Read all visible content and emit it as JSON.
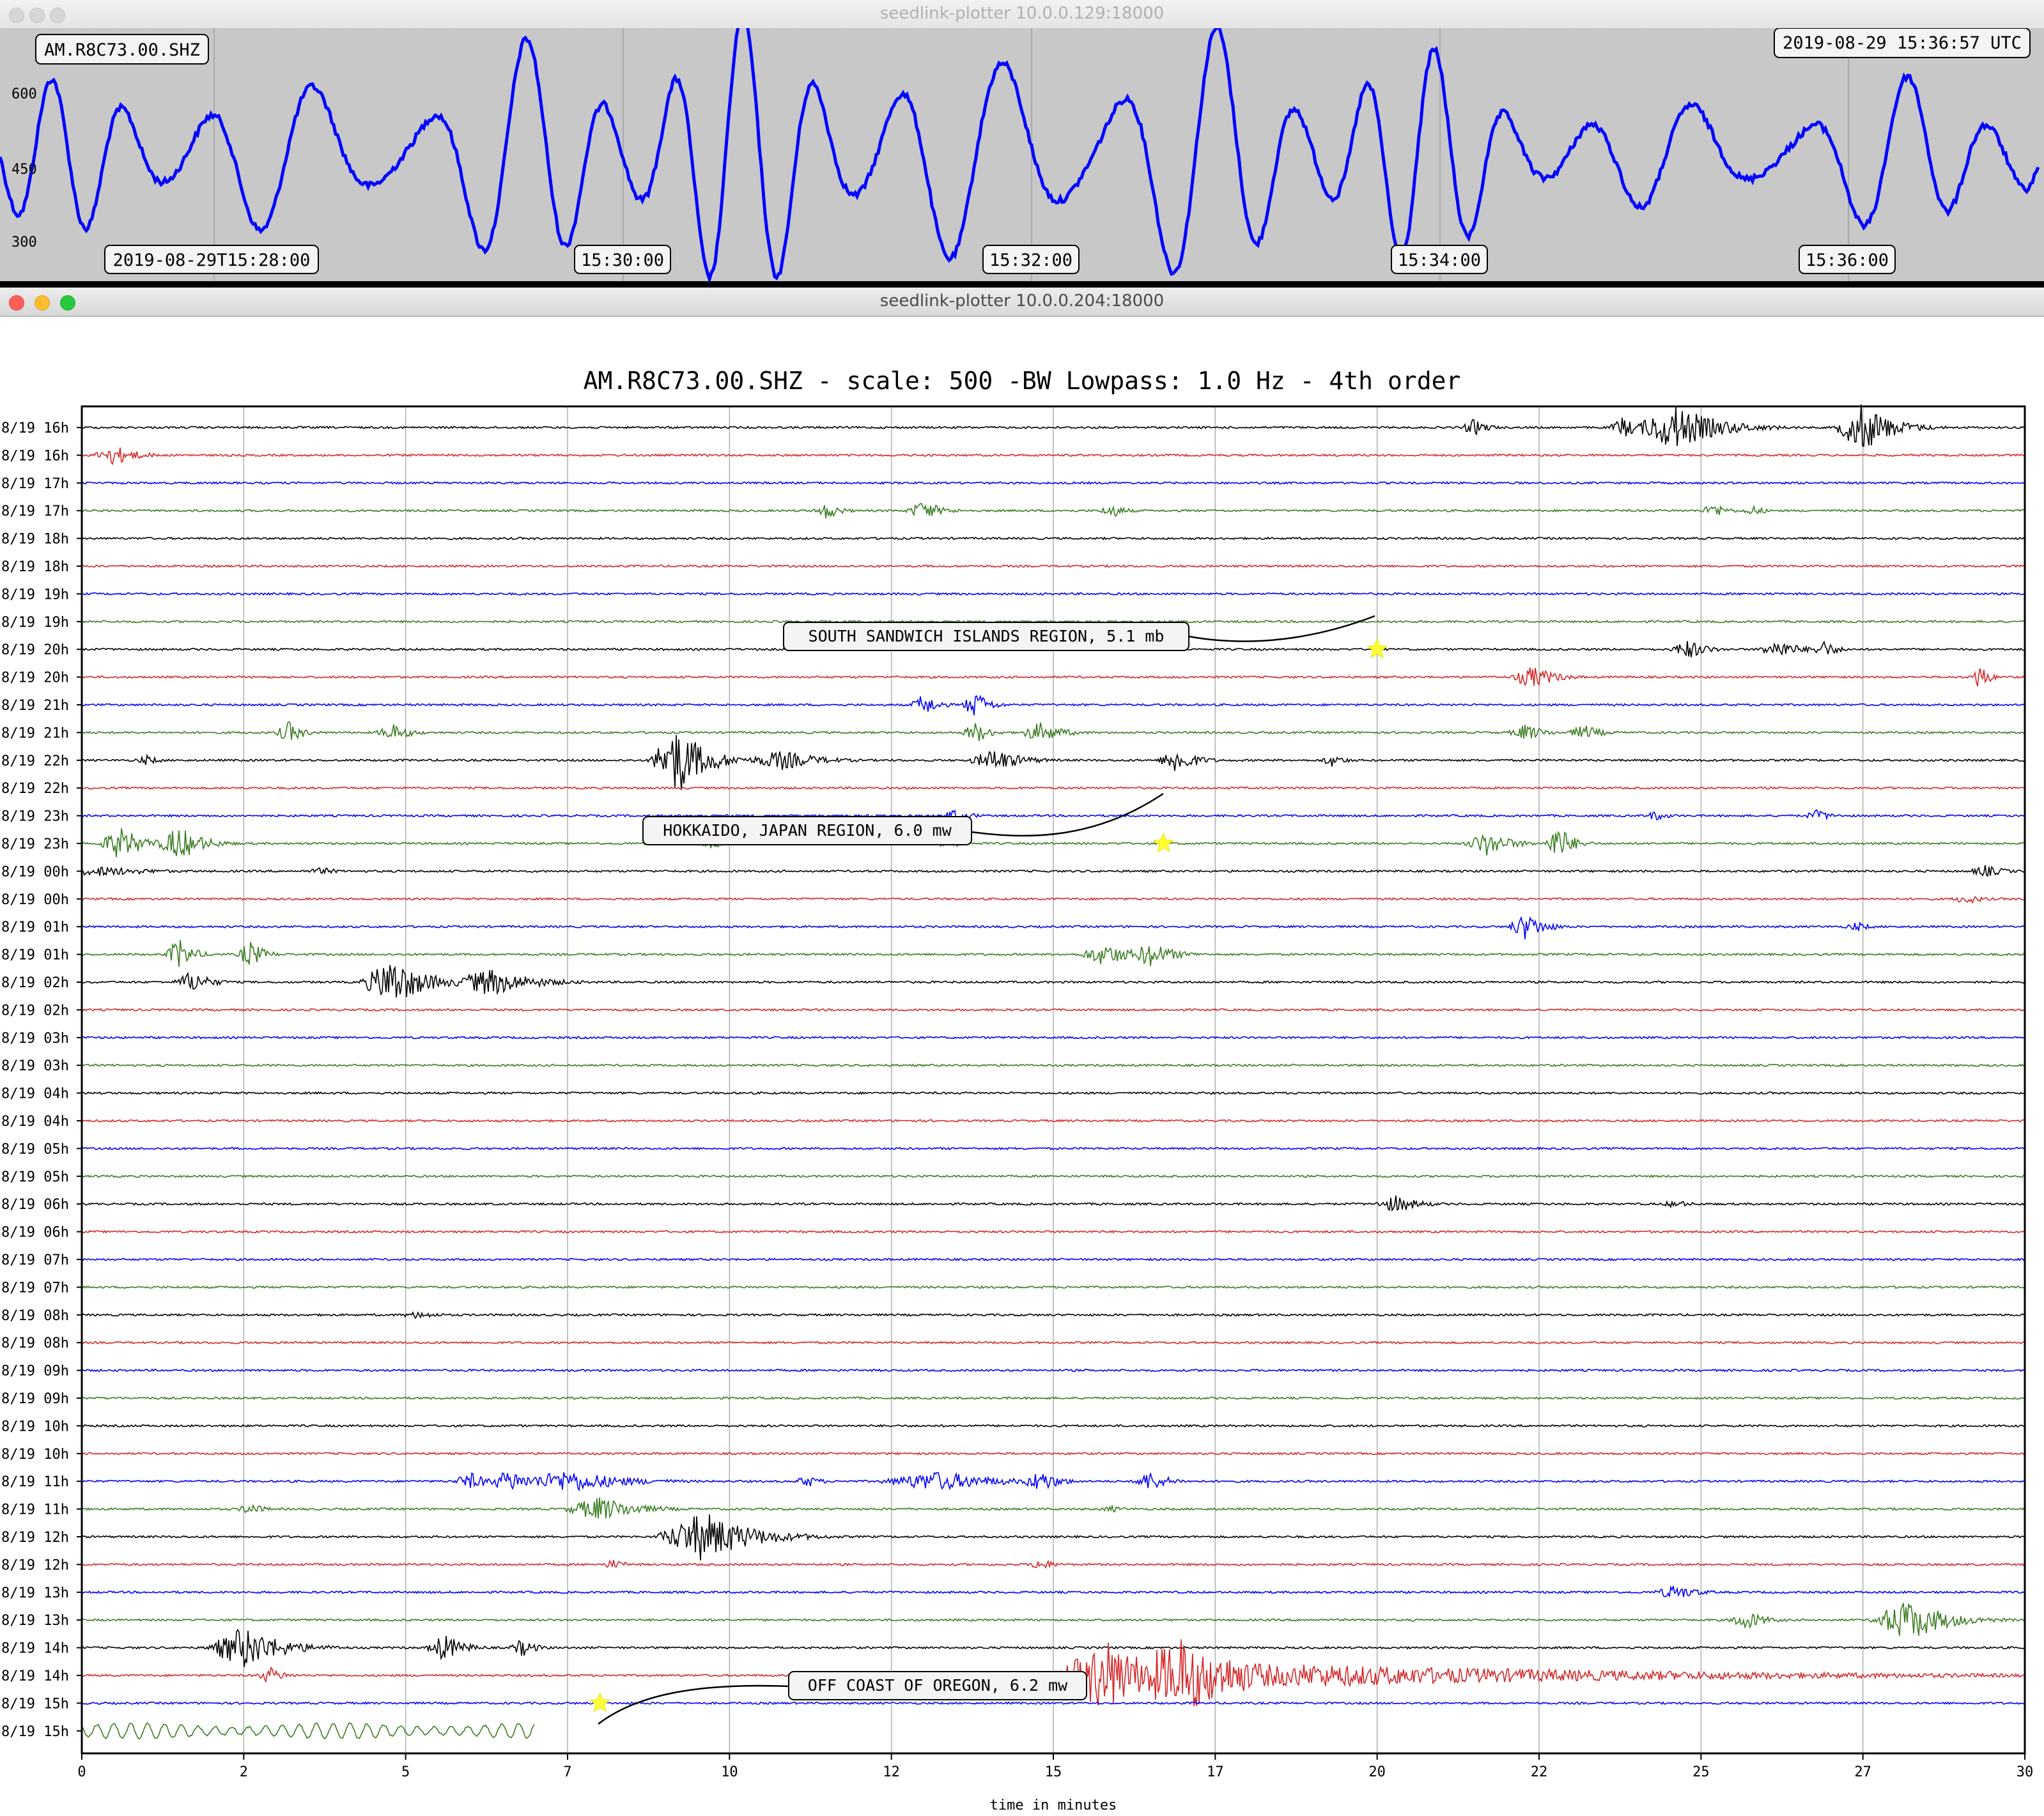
{
  "window_top": {
    "title": "seedlink-plotter 10.0.0.129:18000",
    "trace_label": "AM.R8C73.00.SHZ",
    "timestamp": "2019-08-29 15:36:57 UTC",
    "y_ticks": [
      "600",
      "450",
      "300"
    ],
    "x_ticks": [
      "2019-08-29T15:28:00",
      "15:30:00",
      "15:32:00",
      "15:34:00",
      "15:36:00"
    ],
    "trace_color": "#0000ff",
    "background_color": "#c8c8c8"
  },
  "window_main": {
    "title": "seedlink-plotter 10.0.0.204:18000",
    "plot_title": "AM.R8C73.00.SHZ - scale: 500 -BW Lowpass: 1.0 Hz - 4th order",
    "xlabel": "time in minutes",
    "x_ticks": [
      "0",
      "2",
      "5",
      "7",
      "10",
      "12",
      "15",
      "17",
      "20",
      "22",
      "25",
      "27",
      "30"
    ],
    "row_labels": [
      "8/19 16h",
      "8/19 16h",
      "8/19 17h",
      "8/19 17h",
      "8/19 18h",
      "8/19 18h",
      "8/19 19h",
      "8/19 19h",
      "8/19 20h",
      "8/19 20h",
      "8/19 21h",
      "8/19 21h",
      "8/19 22h",
      "8/19 22h",
      "8/19 23h",
      "8/19 23h",
      "8/19 00h",
      "8/19 00h",
      "8/19 01h",
      "8/19 01h",
      "8/19 02h",
      "8/19 02h",
      "8/19 03h",
      "8/19 03h",
      "8/19 04h",
      "8/19 04h",
      "8/19 05h",
      "8/19 05h",
      "8/19 06h",
      "8/19 06h",
      "8/19 07h",
      "8/19 07h",
      "8/19 08h",
      "8/19 08h",
      "8/19 09h",
      "8/19 09h",
      "8/19 10h",
      "8/19 10h",
      "8/19 11h",
      "8/19 11h",
      "8/19 12h",
      "8/19 12h",
      "8/19 13h",
      "8/19 13h",
      "8/19 14h",
      "8/19 14h",
      "8/19 15h",
      "8/19 15h"
    ],
    "trace_colors": [
      "#000000",
      "#d62728",
      "#0000ff",
      "#3a7d22"
    ],
    "events": [
      {
        "label": "SOUTH SANDWICH ISLANDS REGION, 5.1 mb",
        "row": 8,
        "minute": 20.0
      },
      {
        "label": "HOKKAIDO, JAPAN REGION, 6.0 mw",
        "row": 15,
        "minute": 16.7
      },
      {
        "label": "OFF COAST OF OREGON, 6.2 mw",
        "row": 46,
        "minute": 8.0
      }
    ],
    "star_color": "#ffff33"
  },
  "chart_data": [
    {
      "type": "line",
      "title": "",
      "xlabel": "",
      "ylabel": "",
      "x": [
        "15:28:00",
        "15:30:00",
        "15:32:00",
        "15:34:00",
        "15:36:00"
      ],
      "ylim": [
        300,
        600
      ],
      "series": [
        {
          "name": "AM.R8C73.00.SHZ"
        }
      ]
    },
    {
      "type": "line",
      "title": "AM.R8C73.00.SHZ - scale: 500 -BW Lowpass: 1.0 Hz - 4th order",
      "xlabel": "time in minutes",
      "ylabel": "",
      "xlim": [
        0,
        30
      ],
      "grid": true
    }
  ]
}
